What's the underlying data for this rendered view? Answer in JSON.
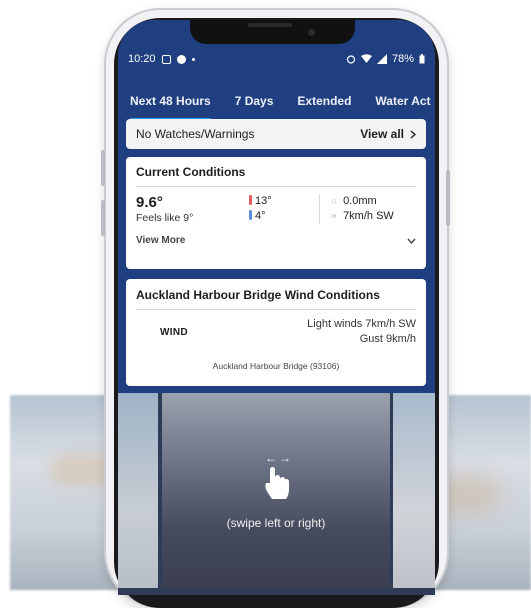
{
  "status_bar": {
    "time": "10:20",
    "battery": "78%"
  },
  "tabs": [
    {
      "label": "Next 48 Hours",
      "active": true
    },
    {
      "label": "7 Days",
      "active": false
    },
    {
      "label": "Extended",
      "active": false
    },
    {
      "label": "Water Act",
      "active": false
    }
  ],
  "warnings": {
    "text": "No Watches/Warnings",
    "action": "View all"
  },
  "current_conditions": {
    "title": "Current Conditions",
    "temperature": "9.6°",
    "feels_like": "Feels like 9°",
    "high": "13°",
    "low": "4°",
    "rain": "0.0mm",
    "wind": "7km/h SW",
    "view_more": "View More"
  },
  "wind_conditions": {
    "title": "Auckland Harbour Bridge Wind Conditions",
    "label": "WIND",
    "line1": "Light winds 7km/h SW",
    "line2": "Gust 9km/h",
    "station": "Auckland Harbour Bridge (93106)"
  },
  "media": {
    "hint": "(swipe left or right)"
  },
  "colors": {
    "app_blue": "#1f3f80",
    "tab_underline": "#3aa0f5",
    "high_temp": "#e05a5a",
    "low_temp": "#5b8fd9"
  }
}
